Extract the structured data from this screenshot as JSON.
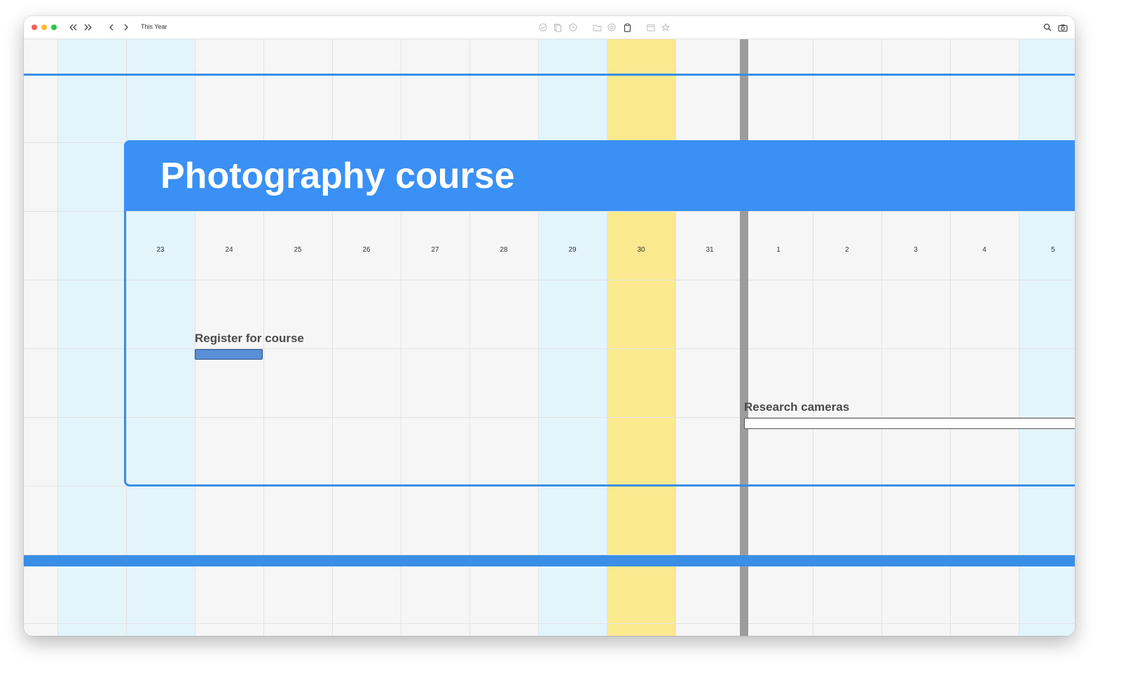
{
  "toolbar": {
    "view_title": "This Year",
    "icons": [
      "double-chevron-left-icon",
      "double-chevron-right-icon",
      "chevron-left-icon",
      "chevron-right-icon",
      "checkmark-circle-icon",
      "documents-icon",
      "clock-circle-icon",
      "folder-icon",
      "target-icon",
      "clipboard-icon",
      "calendar-icon",
      "star-icon",
      "search-icon",
      "camera-icon"
    ]
  },
  "project": {
    "title": "Photography course",
    "color": "#3a90f4"
  },
  "days": [
    "23",
    "24",
    "25",
    "26",
    "27",
    "28",
    "29",
    "30",
    "31",
    "1",
    "2",
    "3",
    "4",
    "5"
  ],
  "today": "30",
  "tasks": [
    {
      "label": "Register for course",
      "status": "filled"
    },
    {
      "label": "Research cameras",
      "status": "empty"
    }
  ],
  "colors": {
    "weekend": "#e3f4fb",
    "today": "#fbe98f",
    "accent": "#3a8ee6",
    "month_divider": "#9c9c9c"
  }
}
